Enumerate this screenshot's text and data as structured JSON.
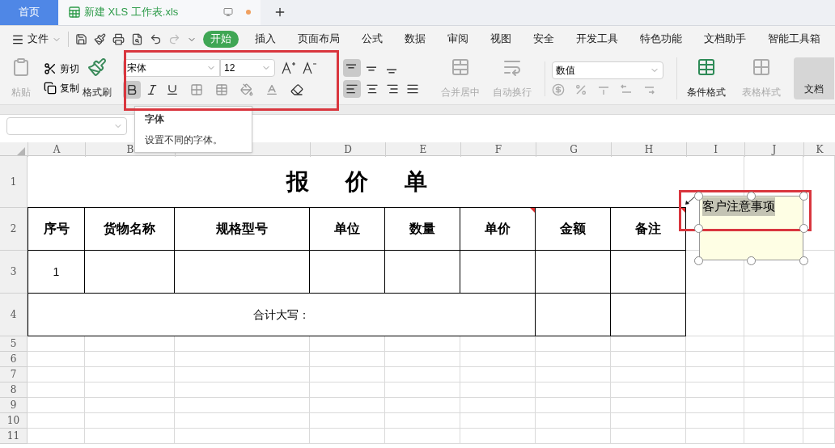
{
  "tabs": [
    {
      "kind": "home",
      "label": "首页",
      "selected": false
    },
    {
      "kind": "file",
      "label": "新建 XLS 工作表.xls",
      "selected": true,
      "unsaved": true
    }
  ],
  "menu": {
    "file": "文件",
    "tabs": [
      {
        "label": "开始",
        "selected": true
      },
      {
        "label": "插入",
        "selected": false
      },
      {
        "label": "页面布局",
        "selected": false
      },
      {
        "label": "公式",
        "selected": false
      },
      {
        "label": "数据",
        "selected": false
      },
      {
        "label": "审阅",
        "selected": false
      },
      {
        "label": "视图",
        "selected": false
      },
      {
        "label": "安全",
        "selected": false
      },
      {
        "label": "开发工具",
        "selected": false
      },
      {
        "label": "特色功能",
        "selected": false
      },
      {
        "label": "文档助手",
        "selected": false
      },
      {
        "label": "智能工具箱",
        "selected": false
      }
    ]
  },
  "ribbon": {
    "paste": {
      "label": "粘贴",
      "disabled": true
    },
    "cut": "剪切",
    "copy": "复制",
    "format_painter": "格式刷",
    "font": {
      "name": "宋体",
      "size": "12"
    },
    "styles": [
      {
        "kind": "bold",
        "selected": true
      },
      {
        "kind": "italic",
        "selected": false
      },
      {
        "kind": "underline",
        "selected": false
      }
    ],
    "valign": [
      {
        "kind": "top",
        "selected": true
      },
      {
        "kind": "middle",
        "selected": false
      },
      {
        "kind": "bottom",
        "selected": false
      }
    ],
    "halign": [
      {
        "kind": "left",
        "selected": true
      },
      {
        "kind": "center",
        "selected": false
      },
      {
        "kind": "right",
        "selected": false
      },
      {
        "kind": "justify",
        "selected": false
      }
    ],
    "merge": {
      "label": "合并居中",
      "disabled": true
    },
    "wrap": {
      "label": "自动换行",
      "disabled": true
    },
    "number_format": "数值",
    "conditional": {
      "label": "条件格式",
      "disabled": false
    },
    "table_style": {
      "label": "表格样式",
      "disabled": true
    },
    "doc": "文档"
  },
  "tooltip": {
    "title": "字体",
    "text": "设置不同的字体。"
  },
  "sheet": {
    "columns": [
      "A",
      "B",
      null,
      "D",
      "E",
      "F",
      "G",
      "H",
      "I",
      "J",
      "K"
    ],
    "rows": [
      "1",
      "2",
      "3",
      "4",
      "5",
      "6",
      "7",
      "8",
      "9",
      "10",
      "11"
    ],
    "title": "报价单",
    "headers": [
      {
        "text": "序号",
        "commented": false
      },
      {
        "text": "货物名称",
        "commented": false
      },
      {
        "text": "规格型号",
        "commented": false
      },
      {
        "text": "单位",
        "commented": false
      },
      {
        "text": "数量",
        "commented": false
      },
      {
        "text": "单价",
        "commented": true
      },
      {
        "text": "金额",
        "commented": false
      },
      {
        "text": "备注",
        "commented": true
      }
    ],
    "data": [
      [
        "1"
      ]
    ],
    "total_label": "合计大写：",
    "comment": "客户注意事项"
  }
}
